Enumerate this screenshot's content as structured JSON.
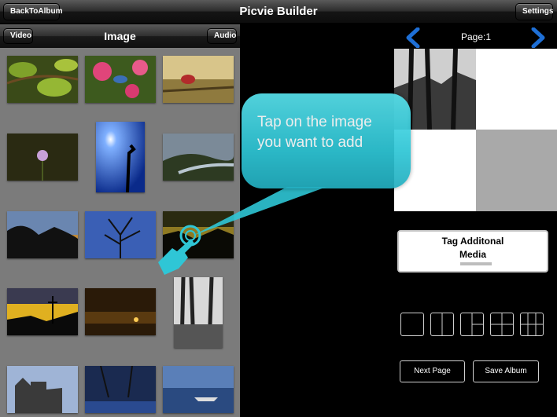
{
  "topbar": {
    "title": "Picvie Builder",
    "back_label": "BackToAlbum",
    "settings_label": "Settings"
  },
  "left_panel": {
    "title": "Image",
    "video_label": "Video",
    "audio_label": "Audio"
  },
  "right_panel": {
    "page_label": "Page:1",
    "tag_line1": "Tag Additonal",
    "tag_line2": "Media",
    "next_page_label": "Next Page",
    "save_album_label": "Save Album"
  },
  "callout": {
    "line1": "Tap on the image",
    "line2": "you want to add"
  },
  "colors": {
    "callout": "#2fc6d6",
    "arrow_blue": "#1e6fd6",
    "gallery_bg": "#7b7b7b"
  },
  "icons": [
    "left-arrow-icon",
    "right-arrow-icon",
    "hand-pointer-icon"
  ]
}
